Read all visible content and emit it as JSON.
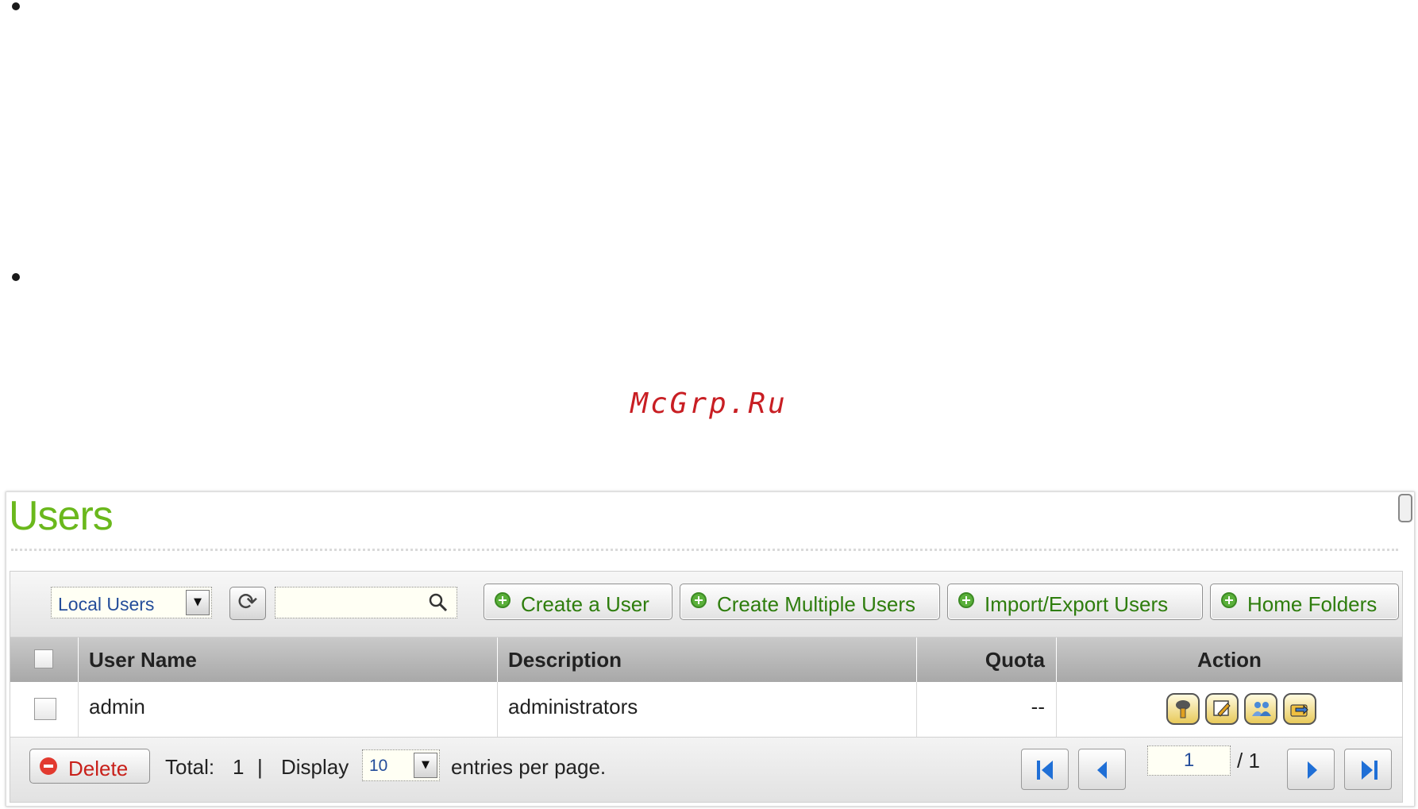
{
  "watermark": "McGrp.Ru",
  "page": {
    "title": "Users"
  },
  "toolbar": {
    "user_type_select": "Local Users",
    "search_placeholder": "",
    "buttons": [
      {
        "label": "Create a User"
      },
      {
        "label": "Create Multiple Users"
      },
      {
        "label": "Import/Export Users"
      },
      {
        "label": "Home Folders"
      }
    ]
  },
  "table": {
    "columns": [
      "User Name",
      "Description",
      "Quota",
      "Action"
    ],
    "rows": [
      {
        "user_name": "admin",
        "description": "administrators",
        "quota": "--",
        "actions": [
          "password-icon",
          "edit-icon",
          "group-icon",
          "share-folder-icon"
        ]
      }
    ]
  },
  "footer": {
    "delete_label": "Delete",
    "total_label": "Total:",
    "total_value": "1",
    "separator": "|",
    "display_label": "Display",
    "per_page_value": "10",
    "entries_label": "entries per page.",
    "current_page": "1",
    "total_pages": "/ 1"
  },
  "colors": {
    "title_green": "#6ab81c",
    "button_text_green": "#2e7d0d",
    "delete_red": "#c8201a",
    "watermark_red": "#c81e23",
    "header_gray": "#b5b5b5",
    "nav_blue": "#1f6fd6"
  }
}
